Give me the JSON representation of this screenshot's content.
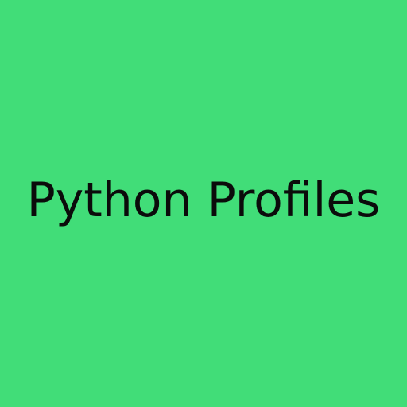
{
  "page": {
    "background_color": "#41DD78",
    "title": "Python Profiles",
    "text_color": "#0B0B0B"
  }
}
